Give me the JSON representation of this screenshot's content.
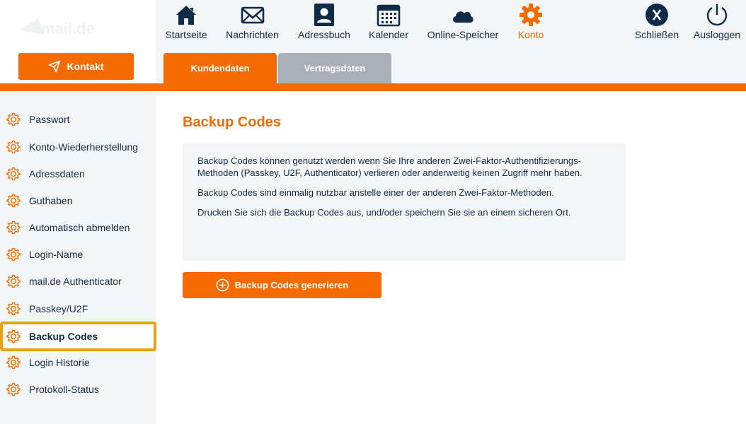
{
  "brand": {
    "logo_text": "mail.de",
    "accent": "#f56b00",
    "navy": "#0f2b4a"
  },
  "contact_button": {
    "label": "Kontakt",
    "icon": "send-icon"
  },
  "nav": [
    {
      "label": "Startseite",
      "icon": "home-icon"
    },
    {
      "label": "Nachrichten",
      "icon": "envelope-icon"
    },
    {
      "label": "Adressbuch",
      "icon": "address-book-icon"
    },
    {
      "label": "Kalender",
      "icon": "calendar-icon"
    },
    {
      "label": "Online-Speicher",
      "icon": "cloud-icon"
    },
    {
      "label": "Konto",
      "icon": "gear-icon",
      "active": true
    }
  ],
  "nav_right": [
    {
      "label": "Schließen",
      "icon": "close-circle-icon"
    },
    {
      "label": "Ausloggen",
      "icon": "power-icon"
    }
  ],
  "tabs": [
    {
      "label": "Kundendaten",
      "active": true
    },
    {
      "label": "Vertragsdaten",
      "active": false
    }
  ],
  "sidebar": {
    "items": [
      {
        "label": "Passwort"
      },
      {
        "label": "Konto-Wiederherstellung"
      },
      {
        "label": "Adressdaten"
      },
      {
        "label": "Guthaben"
      },
      {
        "label": "Automatisch abmelden"
      },
      {
        "label": "Login-Name"
      },
      {
        "label": "mail.de Authenticator"
      },
      {
        "label": "Passkey/U2F"
      },
      {
        "label": "Backup Codes",
        "selected": true
      },
      {
        "label": "Login Historie"
      },
      {
        "label": "Protokoll-Status"
      }
    ]
  },
  "main": {
    "title": "Backup Codes",
    "info_paragraphs": [
      "Backup Codes können genutzt werden wenn Sie Ihre anderen Zwei-Faktor-Authentifizierungs-Methoden (Passkey, U2F, Authenticator) verlieren oder anderweitig keinen Zugriff mehr haben.",
      "Backup Codes sind einmalig nutzbar anstelle einer der anderen Zwei-Faktor-Methoden.",
      "Drucken Sie sich die Backup Codes aus, und/oder speichern Sie sie an einem sicheren Ort."
    ],
    "generate_button": "Backup Codes generieren"
  }
}
